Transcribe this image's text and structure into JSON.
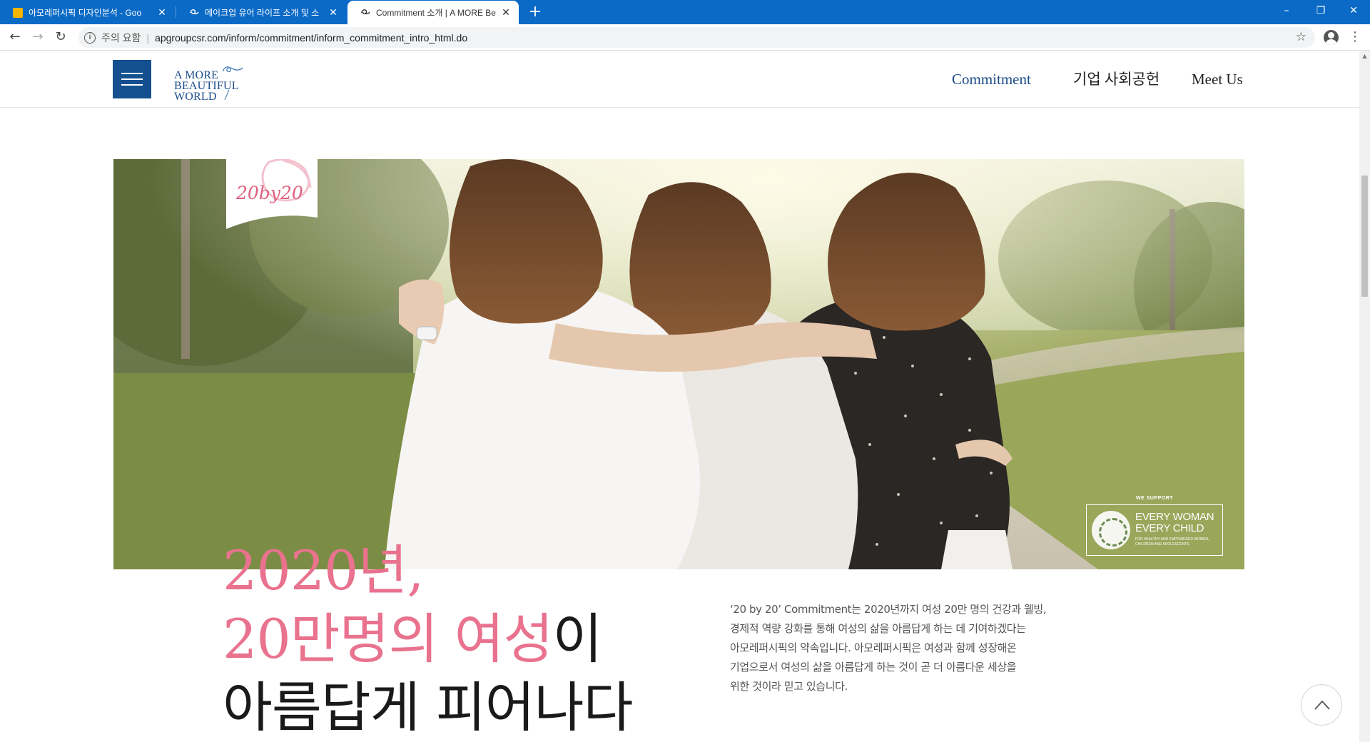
{
  "browser": {
    "tabs": [
      {
        "title": "아모레퍼시픽 디자인분석 - Goo",
        "favicon": "slides-icon"
      },
      {
        "title": "메이크업 유어 라이프 소개 및 소",
        "favicon": "amore-icon"
      },
      {
        "title": "Commitment 소개 | A MORE Be",
        "favicon": "amore-icon",
        "active": true
      }
    ],
    "new_tab": "+",
    "window_controls": {
      "minimize": "–",
      "restore": "❐",
      "close": "✕"
    },
    "address_bar": {
      "security_label": "주의 요함",
      "url": "apgroupcsr.com/inform/commitment/inform_commitment_intro_html.do"
    }
  },
  "site": {
    "logo": {
      "line1": "A MORE",
      "line2": "BEAUTIFUL",
      "line3": "WORLD"
    },
    "nav": [
      "Commitment",
      "기업 사회공헌",
      "Meet Us"
    ],
    "accent_color": "#14508f"
  },
  "hero": {
    "badge_text": "20by20",
    "ewec": {
      "top": "WE SUPPORT",
      "line1": "EVERY WOMAN",
      "line2": "EVERY CHILD",
      "tagline": "FOR HEALTHY AND EMPOWERED WOMEN, CHILDREN AND ADOLESCENTS"
    }
  },
  "headline": {
    "line1": "2020년,",
    "line2_pink": "20만명의 여성",
    "line2_dark": "이",
    "line3": "아름답게 피어나다",
    "pink_color": "#e9728e"
  },
  "description": "‘20 by 20’ Commitment는 2020년까지 여성 20만 명의 건강과 웰빙,\n경제적 역량 강화를 통해 여성의 삶을 아름답게 하는 데 기여하겠다는\n아모레퍼시픽의 약속입니다. 아모레퍼시픽은 여성과 함께 성장해온\n기업으로서 여성의 삶을 아름답게 하는 것이 곧 더 아름다운 세상을\n위한 것이라 믿고 있습니다."
}
